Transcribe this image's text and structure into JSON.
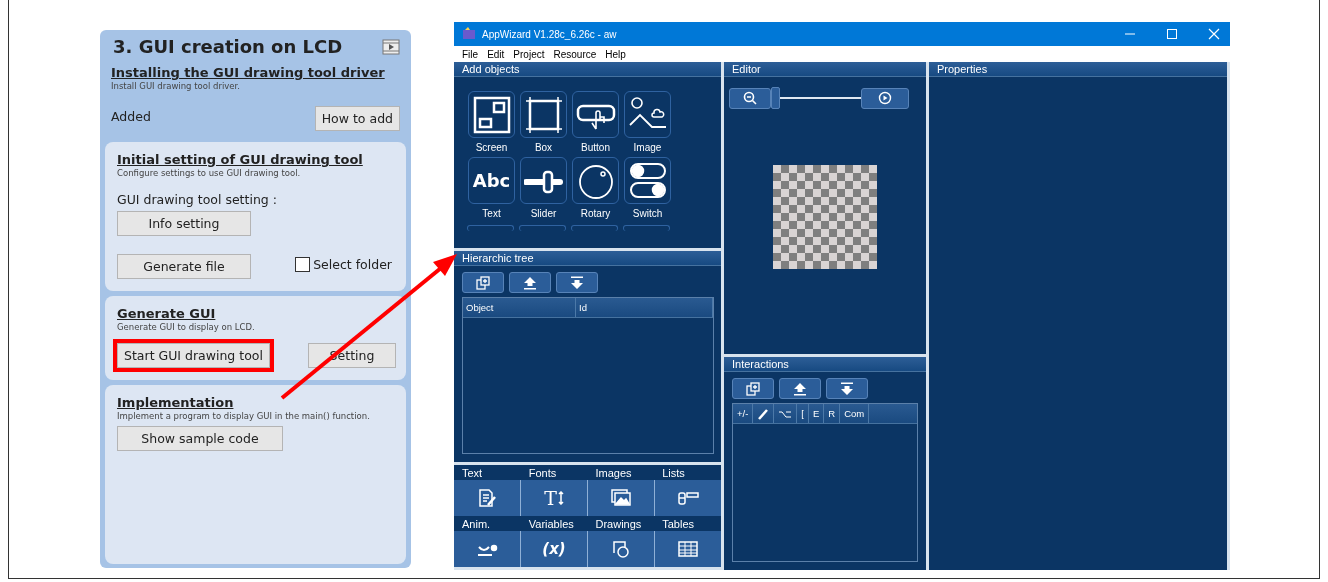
{
  "guide": {
    "title": "3. GUI creation on LCD",
    "install": {
      "heading": "Installing the GUI drawing tool driver",
      "description": "Install GUI drawing tool driver.",
      "status": "Added",
      "button": "How to add"
    },
    "initial": {
      "heading": "Initial setting of GUI drawing tool",
      "description": "Configure settings to use GUI drawing tool.",
      "setting_label": "GUI drawing tool setting :",
      "info_button": "Info setting",
      "generate_button": "Generate file",
      "select_folder": {
        "label": "Select folder",
        "checked": false
      }
    },
    "generate": {
      "heading": "Generate GUI",
      "description": "Generate GUI to display on LCD.",
      "start_button": {
        "label": "Start GUI drawing tool",
        "highlighted": true
      },
      "setting_button": "Setting"
    },
    "implementation": {
      "heading": "Implementation",
      "description": "Implement a program to display GUI in the main() function.",
      "button": "Show sample code"
    }
  },
  "window": {
    "title": "AppWizard V1.28c_6.26c - aw",
    "menu": [
      "File",
      "Edit",
      "Project",
      "Resource",
      "Help"
    ],
    "add_objects": {
      "title": "Add objects",
      "items": [
        {
          "label": "Screen"
        },
        {
          "label": "Box"
        },
        {
          "label": "Button"
        },
        {
          "label": "Image"
        },
        {
          "label": "Text",
          "glyph": "Abc"
        },
        {
          "label": "Slider"
        },
        {
          "label": "Rotary"
        },
        {
          "label": "Switch"
        }
      ]
    },
    "hierarchic_tree": {
      "title": "Hierarchic tree",
      "columns": [
        "Object",
        "Id"
      ]
    },
    "resources": {
      "row_1": [
        {
          "label": "Text"
        },
        {
          "label": "Fonts",
          "glyph": "T"
        },
        {
          "label": "Images"
        },
        {
          "label": "Lists"
        }
      ],
      "row_2": [
        {
          "label": "Anim."
        },
        {
          "label": "Variables",
          "glyph": "(x)"
        },
        {
          "label": "Drawings"
        },
        {
          "label": "Tables"
        }
      ]
    },
    "editor": {
      "title": "Editor",
      "zoom": {
        "level": 0
      }
    },
    "interactions": {
      "title": "Interactions",
      "columns": [
        "+/-",
        "",
        "",
        "[",
        "E",
        "R",
        "Com"
      ]
    },
    "properties": {
      "title": "Properties"
    }
  }
}
